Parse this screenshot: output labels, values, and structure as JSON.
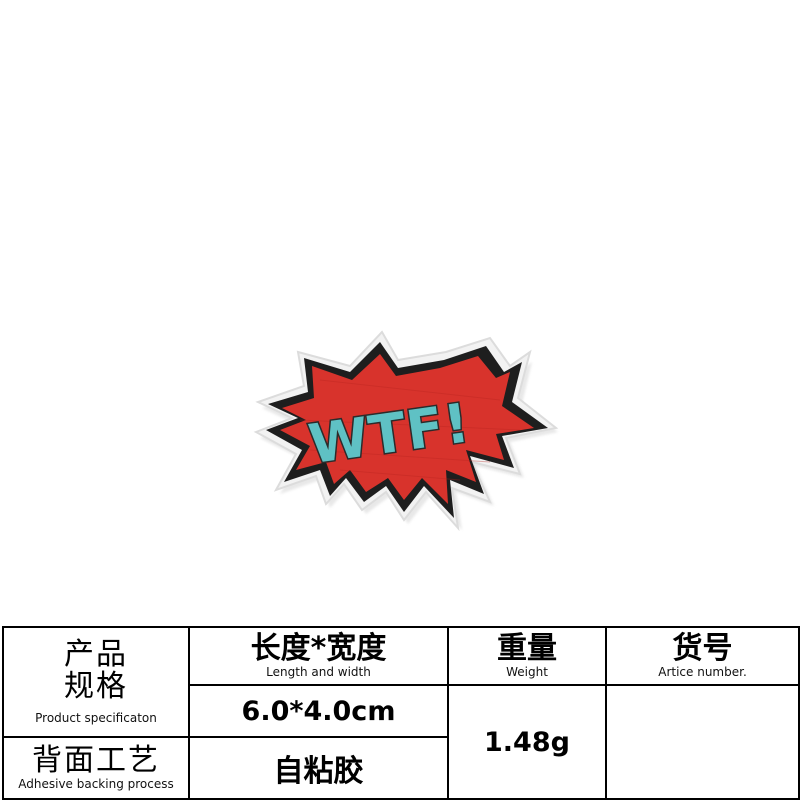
{
  "photo": {
    "subject": "embroidered patch",
    "patch_text": "WTF!",
    "colors": {
      "burst": "#d8332c",
      "outline": "#1a1a1a",
      "border": "#f0f0f0",
      "letters": "#5fc1c4",
      "letter_outline": "#2b2b2b"
    }
  },
  "table": {
    "spec_label_zh_1": "产品",
    "spec_label_zh_2": "规格",
    "spec_label_en": "Product specificaton",
    "backing_label_zh": "背面工艺",
    "backing_label_en": "Adhesive backing process",
    "size_header_zh": "长度*宽度",
    "size_header_en": "Length and width",
    "size_value": "6.0*4.0cm",
    "backing_value": "自粘胶",
    "weight_header_zh": "重量",
    "weight_header_en": "Weight",
    "weight_value": "1.48g",
    "article_header_zh": "货号",
    "article_header_en": "Artice number.",
    "article_value": ""
  }
}
